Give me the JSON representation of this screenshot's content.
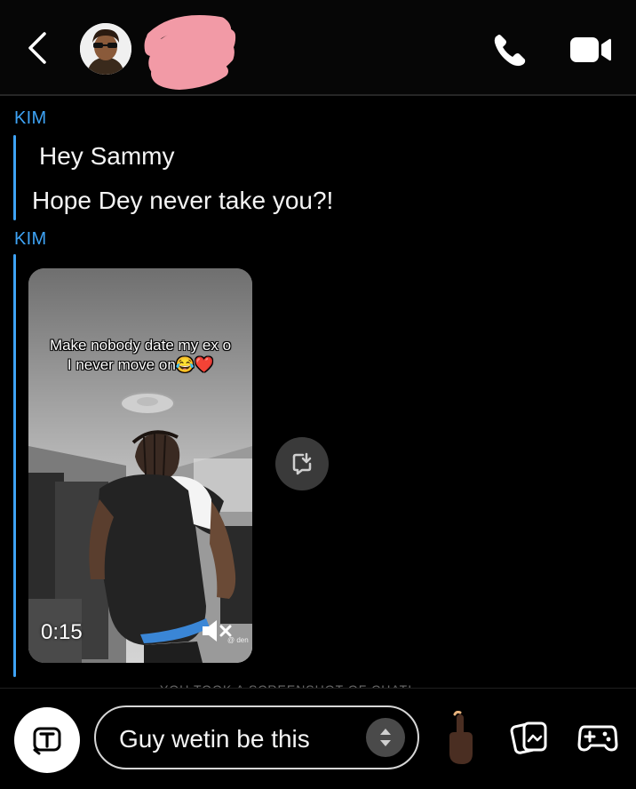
{
  "header": {
    "back_icon": "chevron-left-icon",
    "call_icon": "phone-icon",
    "video_icon": "video-camera-icon",
    "scribble_color": "#f29aa6"
  },
  "chat": {
    "messages": [
      {
        "sender": "KIM",
        "lines": [
          "Hey Sammy",
          "Hope Dey never take you?!"
        ]
      },
      {
        "sender": "KIM",
        "video": {
          "caption_line1": "Make nobody date my ex o",
          "caption_line2": "I never move on😂❤️",
          "duration": "0:15",
          "watermark": "@ den",
          "mute_icon": "speaker-muted-icon"
        }
      }
    ],
    "save_icon": "save-to-chat-icon",
    "accent_color": "#3ea3f5",
    "screenshot_notice": "YOU TOOK A SCREENSHOT OF CHAT!"
  },
  "composer": {
    "text_tool_icon": "text-t-icon",
    "input_value": "Guy wetin be this",
    "stepper_icon": "up-down-arrows-icon",
    "emoji": "☝🏿",
    "gallery_icon": "memories-icon",
    "game_icon": "gamepad-icon"
  }
}
